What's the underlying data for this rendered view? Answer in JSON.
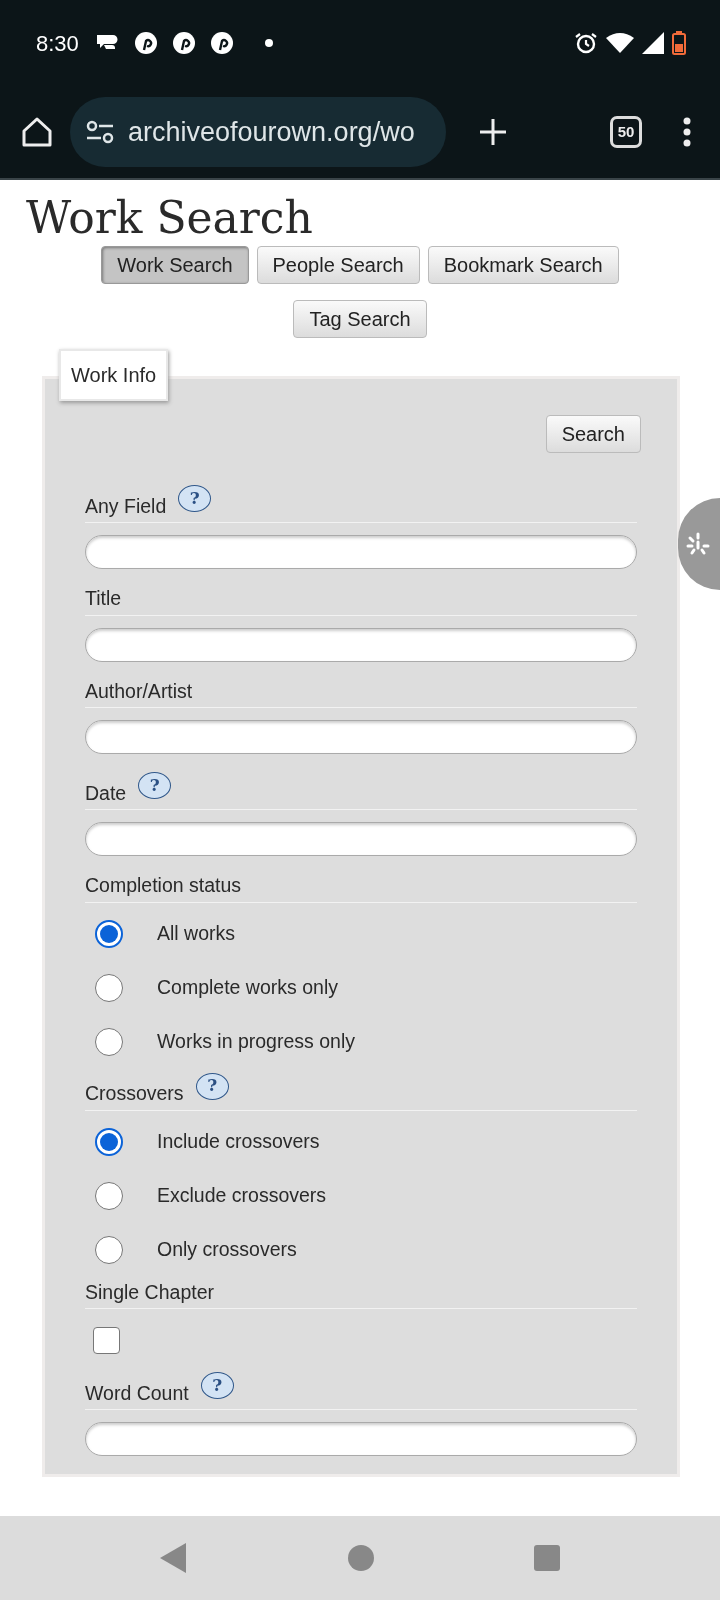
{
  "status_bar": {
    "time": "8:30"
  },
  "browser": {
    "url": "archiveofourown.org/wo",
    "tab_count": "50"
  },
  "page": {
    "title": "Work Search",
    "nav_buttons": [
      {
        "label": "Work Search",
        "selected": true
      },
      {
        "label": "People Search",
        "selected": false
      },
      {
        "label": "Bookmark Search",
        "selected": false
      },
      {
        "label": "Tag Search",
        "selected": false
      }
    ],
    "fieldset": {
      "legend": "Work Info",
      "search_button": "Search",
      "fields": [
        {
          "kind": "text",
          "label": "Any Field",
          "help": "?"
        },
        {
          "kind": "text",
          "label": "Title"
        },
        {
          "kind": "text",
          "label": "Author/Artist"
        },
        {
          "kind": "text",
          "label": "Date",
          "help": "?"
        },
        {
          "kind": "radio",
          "label": "Completion status",
          "options": [
            {
              "label": "All works",
              "selected": true
            },
            {
              "label": "Complete works only",
              "selected": false
            },
            {
              "label": "Works in progress only",
              "selected": false
            }
          ]
        },
        {
          "kind": "radio",
          "label": "Crossovers",
          "help": "?",
          "options": [
            {
              "label": "Include crossovers",
              "selected": true
            },
            {
              "label": "Exclude crossovers",
              "selected": false
            },
            {
              "label": "Only crossovers",
              "selected": false
            }
          ]
        },
        {
          "kind": "checkbox",
          "label": "Single Chapter",
          "checked": false
        },
        {
          "kind": "text",
          "label": "Word Count",
          "help": "?"
        }
      ]
    }
  }
}
